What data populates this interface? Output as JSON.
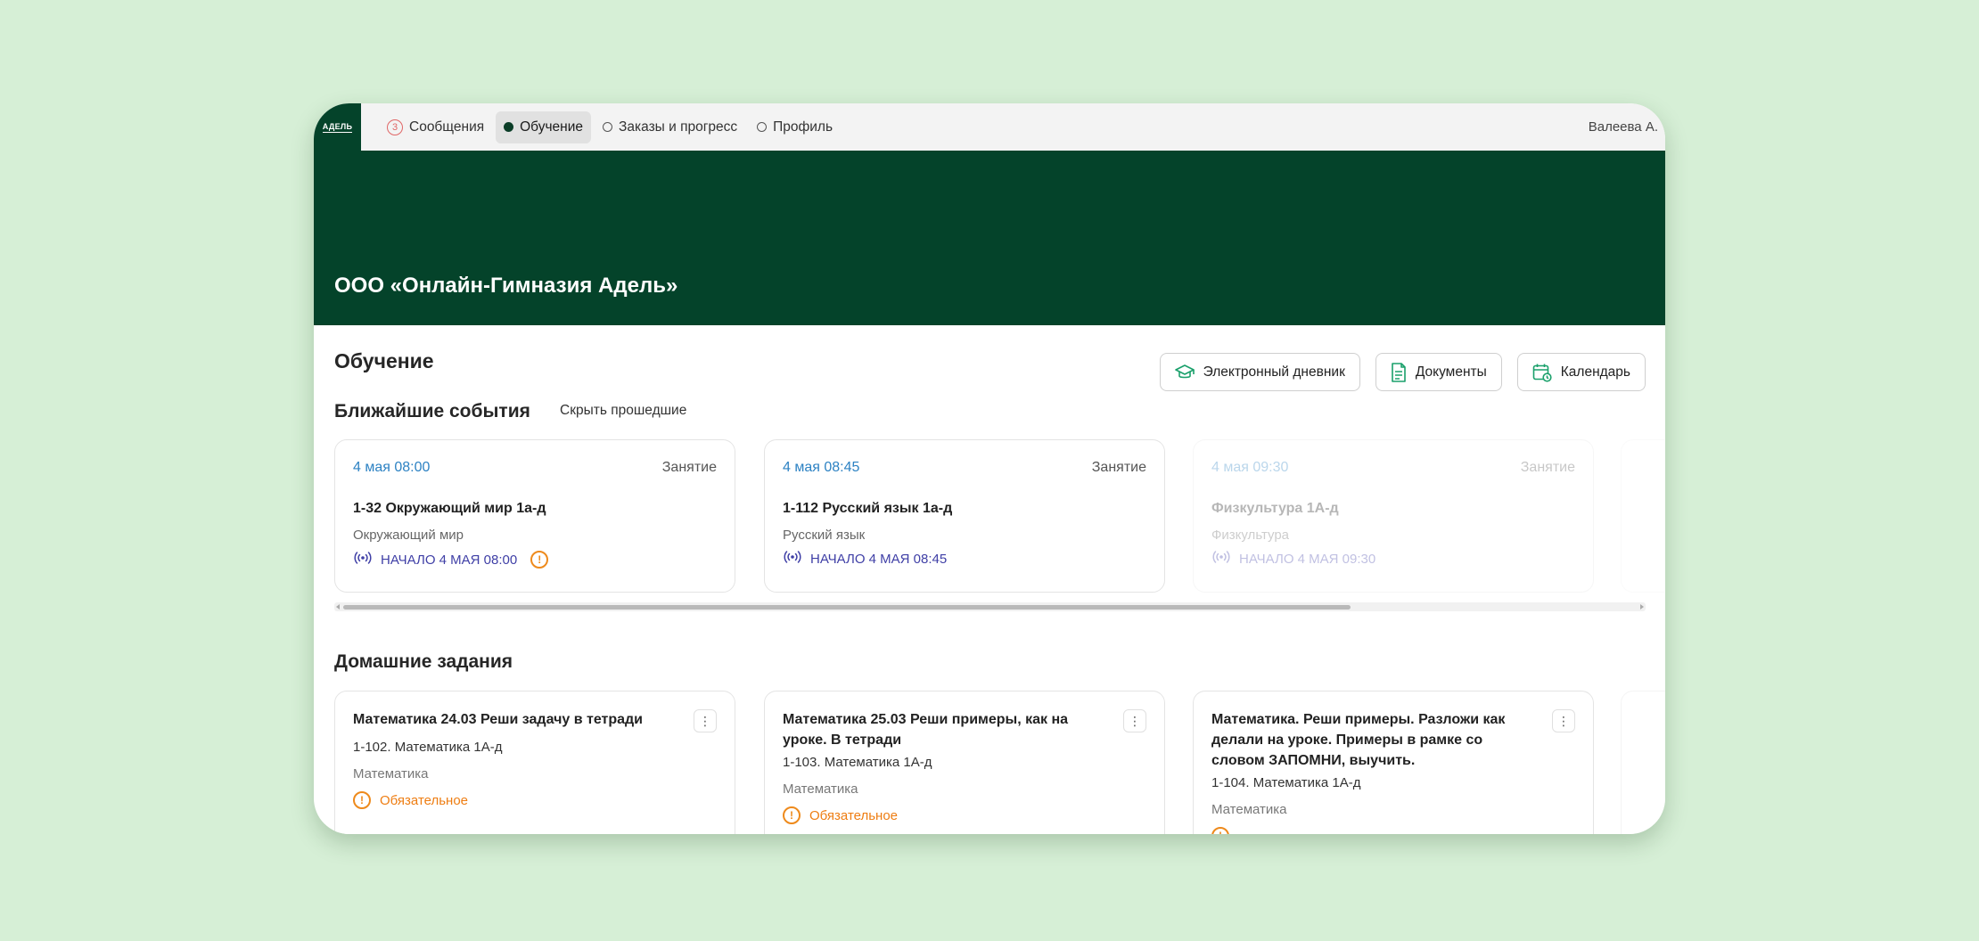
{
  "nav": {
    "logo_text": "АДЕЛЬ",
    "messages_count": "3",
    "items": [
      {
        "label": "Сообщения"
      },
      {
        "label": "Обучение"
      },
      {
        "label": "Заказы и прогресс"
      },
      {
        "label": "Профиль"
      }
    ],
    "user_name": "Валеева А."
  },
  "hero": {
    "title": "ООО «Онлайн-Гимназия Адель»"
  },
  "page": {
    "title": "Обучение",
    "buttons": {
      "diary": "Электронный дневник",
      "documents": "Документы",
      "calendar": "Календарь"
    }
  },
  "events": {
    "title": "Ближайшие события",
    "hide_past": "Скрыть прошедшие",
    "items": [
      {
        "date": "4 мая 08:00",
        "type": "Занятие",
        "title": "1-32 Окружающий мир 1а-д",
        "subject": "Окружающий мир",
        "start": "НАЧАЛО 4 МАЯ 08:00",
        "warning": "!"
      },
      {
        "date": "4 мая 08:45",
        "type": "Занятие",
        "title": "1-112 Русский язык 1а-д",
        "subject": "Русский язык",
        "start": "НАЧАЛО 4 МАЯ 08:45"
      },
      {
        "date": "4 мая 09:30",
        "type": "Занятие",
        "title": "Физкультура 1А-д",
        "subject": "Физкультура",
        "start": "НАЧАЛО 4 МАЯ 09:30"
      }
    ]
  },
  "homework": {
    "title": "Домашние задания",
    "items": [
      {
        "title": "Математика 24.03 Реши задачу в тетради",
        "group": "1-102. Математика 1А-д",
        "subject": "Математика",
        "status": "Обязательное"
      },
      {
        "title": "Математика 25.03 Реши примеры, как на уроке. В тетради",
        "group": "1-103. Математика 1А-д",
        "subject": "Математика",
        "status": "Обязательное"
      },
      {
        "title": "Математика. Реши примеры. Разложи как делали на уроке. Примеры в рамке со словом ЗАПОМНИ, выучить.",
        "group": "1-104. Математика 1А-д",
        "subject": "Математика"
      }
    ]
  },
  "colors": {
    "brand_dark_green": "#04432a",
    "background": "#d6efd6",
    "event_date": "#2d82c3",
    "live_text": "#3f3fa6",
    "warning": "#ee7d12",
    "button_icon": "#1aa06b"
  }
}
